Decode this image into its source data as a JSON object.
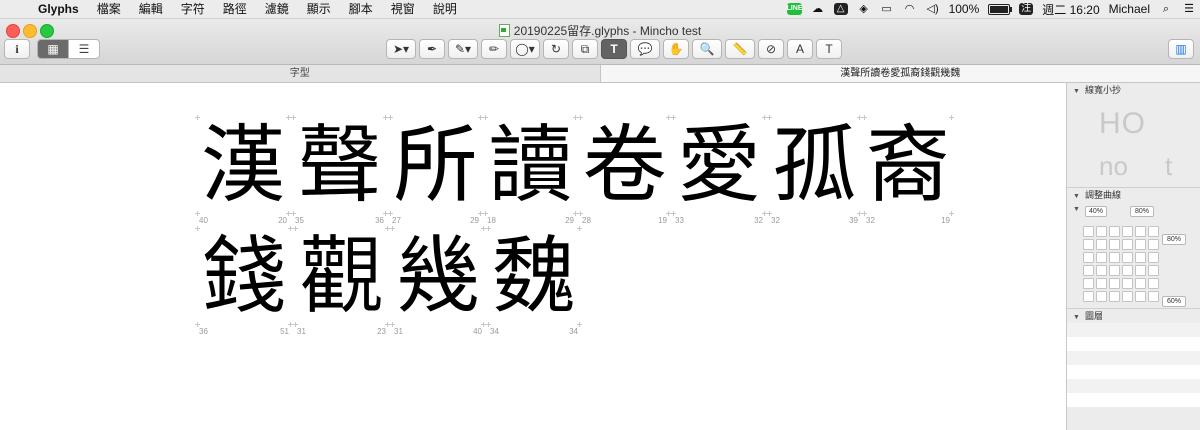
{
  "menubar": {
    "apple": "",
    "app_name": "Glyphs",
    "items": [
      "檔案",
      "編輯",
      "字符",
      "路徑",
      "濾鏡",
      "顯示",
      "腳本",
      "視窗",
      "說明"
    ],
    "status": {
      "line_icon": "LINE",
      "battery_percent": "100%",
      "battery_level": 1.0,
      "ime": "注",
      "clock": "週二 16:20",
      "user": "Michael"
    }
  },
  "window": {
    "title": "20190225留存.glyphs - Mincho test"
  },
  "toolbar": {
    "info_label": "i",
    "tools": [
      {
        "icon": "select-tool",
        "glyph": "➤▾"
      },
      {
        "icon": "draw-tool",
        "glyph": "✒"
      },
      {
        "icon": "pen-tool",
        "glyph": "✎▾"
      },
      {
        "icon": "pencil-tool",
        "glyph": "✏"
      },
      {
        "icon": "shape-tool",
        "glyph": "◯▾"
      },
      {
        "icon": "rotate-tool",
        "glyph": "↻"
      },
      {
        "icon": "scale-tool",
        "glyph": "⧉"
      },
      {
        "icon": "text-tool",
        "glyph": "T"
      },
      {
        "icon": "annotation-tool",
        "glyph": "💬"
      },
      {
        "icon": "hand-tool",
        "glyph": "✋"
      },
      {
        "icon": "zoom-tool",
        "glyph": "🔍"
      },
      {
        "icon": "measure-tool",
        "glyph": "📏"
      },
      {
        "icon": "knife-tool",
        "glyph": "⊘"
      },
      {
        "icon": "components-tool",
        "glyph": "A"
      },
      {
        "icon": "glyph-info-tool",
        "glyph": "T"
      }
    ],
    "active_tool_index": 7,
    "sidebar_toggle_glyph": "▥"
  },
  "tabs": [
    {
      "label": "字型",
      "active": false
    },
    {
      "label": "漢聲所讀卷愛孤裔錢觀幾魏",
      "active": true
    }
  ],
  "glyph_rows": [
    [
      {
        "char": "漢",
        "lsb": "40",
        "rsb": "20"
      },
      {
        "char": "聲",
        "lsb": "35",
        "rsb": "36"
      },
      {
        "char": "所",
        "lsb": "27",
        "rsb": "29"
      },
      {
        "char": "讀",
        "lsb": "18",
        "rsb": "29"
      },
      {
        "char": "卷",
        "lsb": "28",
        "rsb": "19"
      },
      {
        "char": "愛",
        "lsb": "33",
        "rsb": "32"
      },
      {
        "char": "孤",
        "lsb": "32",
        "rsb": "39"
      },
      {
        "char": "裔",
        "lsb": "32",
        "rsb": "19"
      }
    ],
    [
      {
        "char": "錢",
        "lsb": "36",
        "rsb": "51"
      },
      {
        "char": "觀",
        "lsb": "31",
        "rsb": "23"
      },
      {
        "char": "幾",
        "lsb": "31",
        "rsb": "40"
      },
      {
        "char": "魏",
        "lsb": "34",
        "rsb": "34"
      }
    ]
  ],
  "inspector": {
    "panels": {
      "preview_title": "線寬小抄",
      "curve_title": "調整曲線",
      "layers_title": "圖層"
    },
    "preview_text": {
      "line1": "HO",
      "line2a": "no",
      "line2b": "t"
    },
    "curve": {
      "left": "40%",
      "top": "80%",
      "right_top": "80%",
      "right_bottom": "60%"
    }
  }
}
